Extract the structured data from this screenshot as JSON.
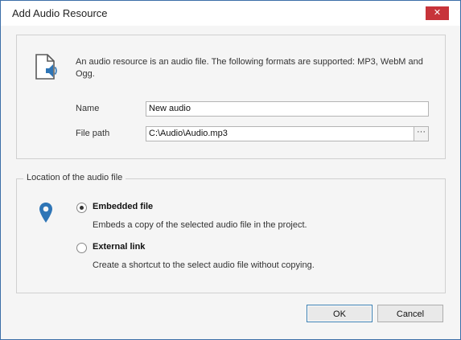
{
  "window": {
    "title": "Add Audio Resource",
    "close_glyph": "✕"
  },
  "info": {
    "icon": "audio-file-icon",
    "description": "An audio resource is an audio file. The following formats are supported: MP3, WebM and Ogg."
  },
  "form": {
    "name_label": "Name",
    "name_value": "New audio",
    "path_label": "File path",
    "path_value": "C:\\Audio\\Audio.mp3",
    "browse_label": "···"
  },
  "location": {
    "group_title": "Location of the audio file",
    "icon": "location-pin-icon",
    "options": [
      {
        "label": "Embedded file",
        "description": "Embeds a copy of the selected audio file in the project.",
        "selected": true
      },
      {
        "label": "External link",
        "description": "Create a shortcut to the select audio file without copying.",
        "selected": false
      }
    ]
  },
  "buttons": {
    "ok": "OK",
    "cancel": "Cancel"
  },
  "colors": {
    "accent": "#3c7fb1",
    "close": "#c7343a",
    "icon": "#2e75b6"
  }
}
